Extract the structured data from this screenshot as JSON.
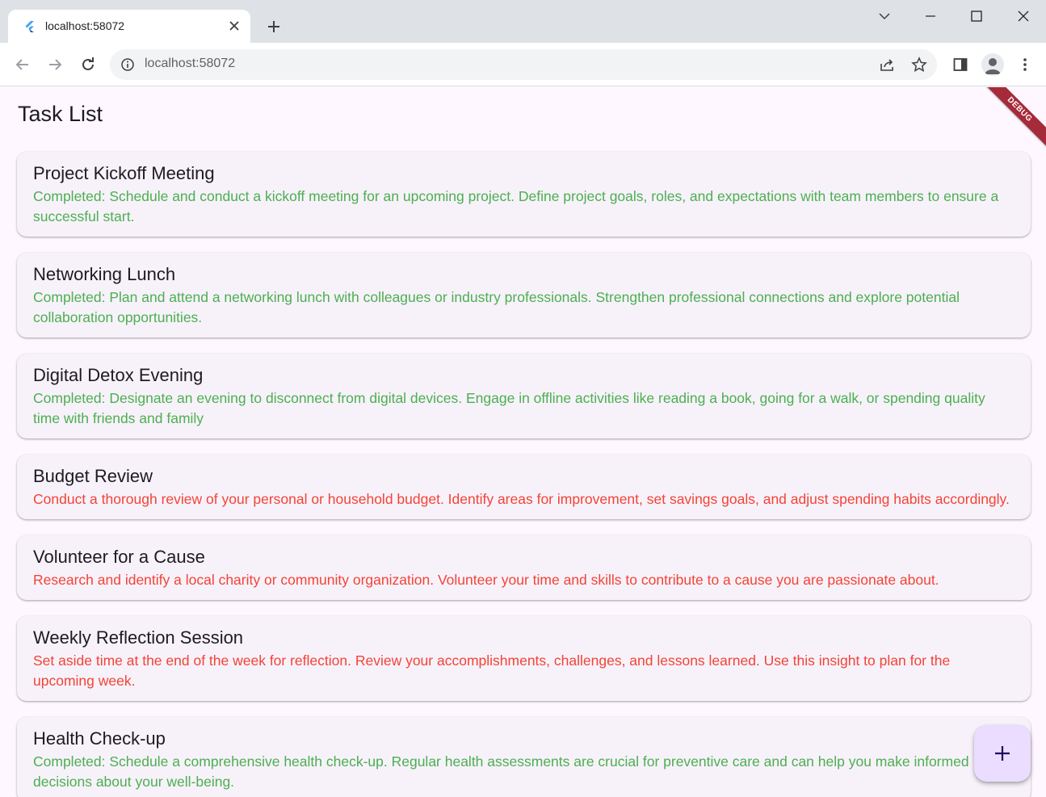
{
  "browser": {
    "tab_title": "localhost:58072",
    "tab_favicon": "flutter-icon",
    "address": "localhost:58072",
    "icons": {
      "close_tab": "close-icon",
      "new_tab": "plus-icon",
      "back": "arrow-left-icon",
      "forward": "arrow-right-icon",
      "reload": "reload-icon",
      "site_info": "info-icon",
      "share": "share-icon",
      "bookmark": "star-icon",
      "side_panel": "side-panel-icon",
      "profile": "profile-icon",
      "menu": "kebab-menu-icon",
      "tab_search": "chevron-down-icon",
      "minimize": "minimize-icon",
      "maximize": "maximize-icon",
      "close_window": "close-icon"
    }
  },
  "app": {
    "title": "Task List",
    "debug_banner": "DEBUG",
    "colors": {
      "completed": "#4caf50",
      "pending": "#f44336",
      "card_bg": "#f7f2fa",
      "fab_bg": "#eaddff"
    },
    "tasks": [
      {
        "title": "Project Kickoff Meeting",
        "description": "Completed: Schedule and conduct a kickoff meeting for an upcoming project. Define project goals, roles, and expectations with team members to ensure a successful start.",
        "completed": true
      },
      {
        "title": "Networking Lunch",
        "description": "Completed: Plan and attend a networking lunch with colleagues or industry professionals. Strengthen professional connections and explore potential collaboration opportunities.",
        "completed": true
      },
      {
        "title": "Digital Detox Evening",
        "description": "Completed: Designate an evening to disconnect from digital devices. Engage in offline activities like reading a book, going for a walk, or spending quality time with friends and family",
        "completed": true
      },
      {
        "title": "Budget Review",
        "description": "Conduct a thorough review of your personal or household budget. Identify areas for improvement, set savings goals, and adjust spending habits accordingly.",
        "completed": false
      },
      {
        "title": "Volunteer for a Cause",
        "description": "Research and identify a local charity or community organization. Volunteer your time and skills to contribute to a cause you are passionate about.",
        "completed": false
      },
      {
        "title": "Weekly Reflection Session",
        "description": "Set aside time at the end of the week for reflection. Review your accomplishments, challenges, and lessons learned. Use this insight to plan for the upcoming week.",
        "completed": false
      },
      {
        "title": "Health Check-up",
        "description": "Completed: Schedule a comprehensive health check-up. Regular health assessments are crucial for preventive care and can help you make informed decisions about your well-being.",
        "completed": true
      }
    ],
    "fab_icon": "plus-icon"
  }
}
